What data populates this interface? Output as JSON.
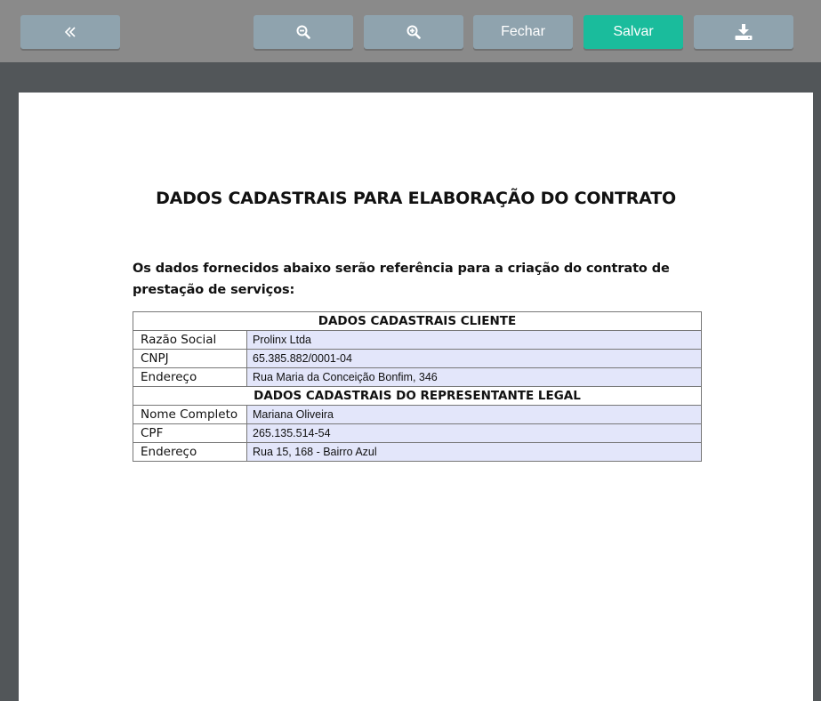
{
  "toolbar": {
    "back_icon": "double-chevron-left-icon",
    "zoom_out_icon": "zoom-out-icon",
    "zoom_in_icon": "zoom-in-icon",
    "close_label": "Fechar",
    "save_label": "Salvar",
    "download_icon": "download-icon",
    "colors": {
      "button": "#8fa3ae",
      "primary": "#1abc9c",
      "bar": "#8a8a8a"
    }
  },
  "document": {
    "title": "DADOS CADASTRAIS PARA ELABORAÇÃO DO CONTRATO",
    "intro": "Os dados fornecidos abaixo serão referência para a criação do contrato de prestação de serviços:",
    "sections": [
      {
        "heading": "DADOS CADASTRAIS CLIENTE",
        "rows": [
          {
            "label": "Razão Social",
            "value": "Prolinx Ltda"
          },
          {
            "label": "CNPJ",
            "value": "65.385.882/0001-04"
          },
          {
            "label": "Endereço",
            "value": "Rua Maria da Conceição Bonfim, 346"
          }
        ]
      },
      {
        "heading": "DADOS CADASTRAIS DO REPRESENTANTE LEGAL",
        "rows": [
          {
            "label": "Nome Completo",
            "value": "Mariana Oliveira"
          },
          {
            "label": "CPF",
            "value": "265.135.514-54"
          },
          {
            "label": "Endereço",
            "value": "Rua 15, 168 - Bairro Azul"
          }
        ]
      }
    ],
    "colors": {
      "field_bg": "#e3e6fa",
      "viewer_bg": "#525659"
    }
  }
}
